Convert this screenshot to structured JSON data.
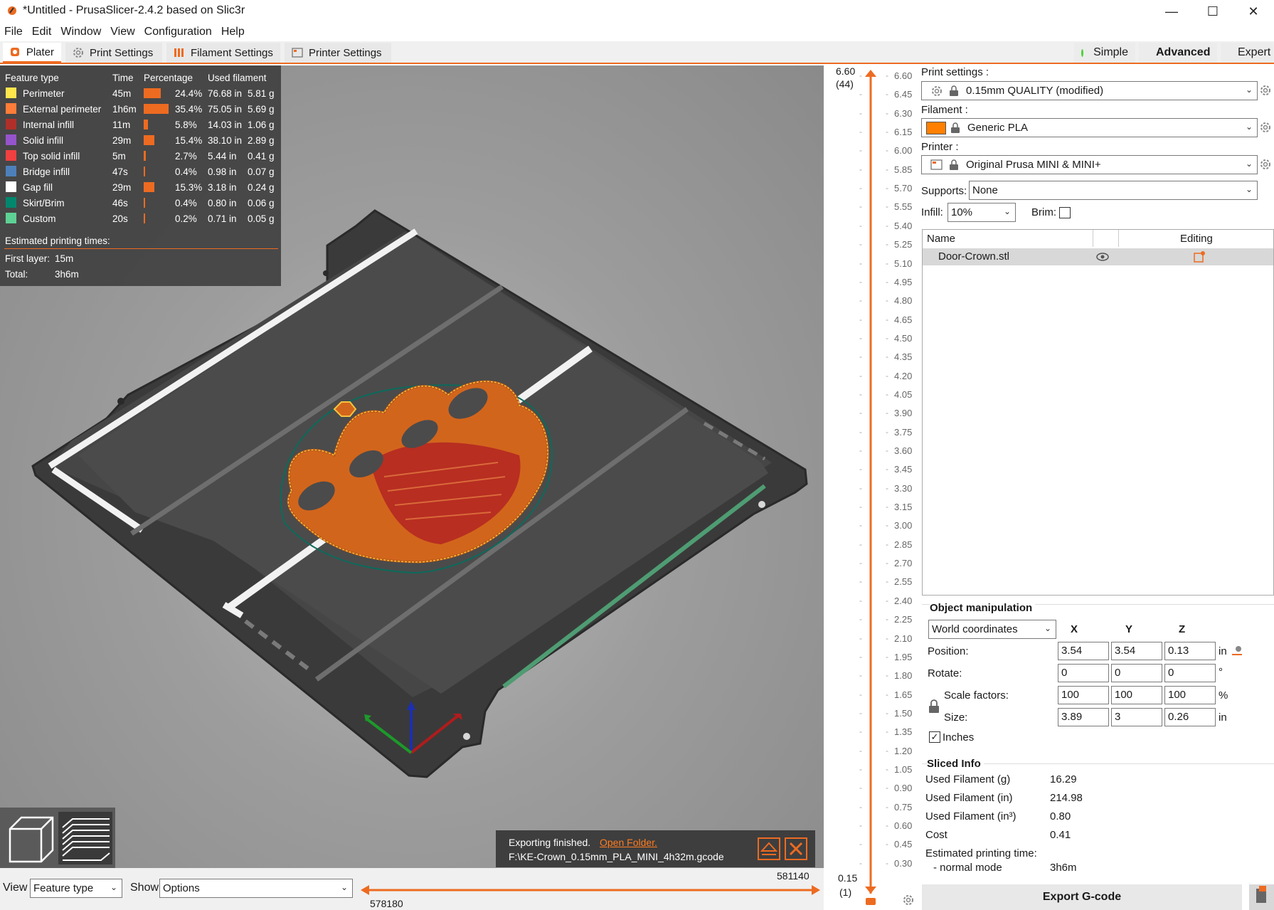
{
  "window": {
    "title": "*Untitled - PrusaSlicer-2.4.2 based on Slic3r",
    "minimize": "—",
    "maximize": "☐",
    "close": "✕"
  },
  "menu": [
    "File",
    "Edit",
    "Window",
    "View",
    "Configuration",
    "Help"
  ],
  "tabs": [
    {
      "label": "Plater",
      "active": true
    },
    {
      "label": "Print Settings",
      "active": false
    },
    {
      "label": "Filament Settings",
      "active": false
    },
    {
      "label": "Printer Settings",
      "active": false
    }
  ],
  "modes": [
    {
      "label": "Simple",
      "color": "#4cd137"
    },
    {
      "label": "Advanced",
      "color": "#f5c518",
      "active": true
    },
    {
      "label": "Expert",
      "color": "#d40000"
    }
  ],
  "legend": {
    "headers": {
      "feature": "Feature type",
      "time": "Time",
      "percentage": "Percentage",
      "used": "Used filament"
    },
    "rows": [
      {
        "name": "Perimeter",
        "time": "45m",
        "pct": "24.4%",
        "len": "76.68 in",
        "wt": "5.81 g",
        "color": "#ffe64d",
        "frac": 0.244
      },
      {
        "name": "External perimeter",
        "time": "1h6m",
        "pct": "35.4%",
        "len": "75.05 in",
        "wt": "5.69 g",
        "color": "#ff7d38",
        "frac": 0.354
      },
      {
        "name": "Internal infill",
        "time": "11m",
        "pct": "5.8%",
        "len": "14.03 in",
        "wt": "1.06 g",
        "color": "#b03029",
        "frac": 0.058
      },
      {
        "name": "Solid infill",
        "time": "29m",
        "pct": "15.4%",
        "len": "38.10 in",
        "wt": "2.89 g",
        "color": "#9654cc",
        "frac": 0.154
      },
      {
        "name": "Top solid infill",
        "time": "5m",
        "pct": "2.7%",
        "len": "5.44 in",
        "wt": "0.41 g",
        "color": "#f04040",
        "frac": 0.027
      },
      {
        "name": "Bridge infill",
        "time": "47s",
        "pct": "0.4%",
        "len": "0.98 in",
        "wt": "0.07 g",
        "color": "#4d80ba",
        "frac": 0.004
      },
      {
        "name": "Gap fill",
        "time": "29m",
        "pct": "15.3%",
        "len": "3.18 in",
        "wt": "0.24 g",
        "color": "#ffffff",
        "frac": 0.153
      },
      {
        "name": "Skirt/Brim",
        "time": "46s",
        "pct": "0.4%",
        "len": "0.80 in",
        "wt": "0.06 g",
        "color": "#00876e",
        "frac": 0.004
      },
      {
        "name": "Custom",
        "time": "20s",
        "pct": "0.2%",
        "len": "0.71 in",
        "wt": "0.05 g",
        "color": "#5ed194",
        "frac": 0.002
      }
    ],
    "estimated_label": "Estimated printing times:",
    "first_layer_label": "First layer:",
    "first_layer_value": "15m",
    "total_label": "Total:",
    "total_value": "3h6m"
  },
  "vscale": {
    "top_value": "6.60",
    "top_layer": "(44)",
    "bottom_value": "0.15",
    "bottom_layer": "(1)",
    "ticks": [
      "6.60",
      "6.45",
      "6.30",
      "6.15",
      "6.00",
      "5.85",
      "5.70",
      "5.55",
      "5.40",
      "5.25",
      "5.10",
      "4.95",
      "4.80",
      "4.65",
      "4.50",
      "4.35",
      "4.20",
      "4.05",
      "3.90",
      "3.75",
      "3.60",
      "3.45",
      "3.30",
      "3.15",
      "3.00",
      "2.85",
      "2.70",
      "2.55",
      "2.40",
      "2.25",
      "2.10",
      "1.95",
      "1.80",
      "1.65",
      "1.50",
      "1.35",
      "1.20",
      "1.05",
      "0.90",
      "0.75",
      "0.60",
      "0.45",
      "0.30"
    ]
  },
  "sidebar": {
    "print_settings_label": "Print settings :",
    "print_settings_value": "0.15mm QUALITY (modified)",
    "filament_label": "Filament :",
    "filament_value": "Generic PLA",
    "filament_color": "#ff8000",
    "printer_label": "Printer :",
    "printer_value": "Original Prusa MINI & MINI+",
    "supports_label": "Supports:",
    "supports_value": "None",
    "infill_label": "Infill:",
    "infill_value": "10%",
    "brim_label": "Brim:",
    "list_headers": {
      "name": "Name",
      "editing": "Editing"
    },
    "objects": [
      {
        "name": "Door-Crown.stl"
      }
    ]
  },
  "object_manipulation": {
    "title": "Object manipulation",
    "coords": "World coordinates",
    "axes": [
      "X",
      "Y",
      "Z"
    ],
    "position_label": "Position:",
    "position": [
      "3.54",
      "3.54",
      "0.13"
    ],
    "position_unit": "in",
    "rotate_label": "Rotate:",
    "rotate": [
      "0",
      "0",
      "0"
    ],
    "rotate_unit": "°",
    "scale_label": "Scale factors:",
    "scale": [
      "100",
      "100",
      "100"
    ],
    "scale_unit": "%",
    "size_label": "Size:",
    "size": [
      "3.89",
      "3",
      "0.26"
    ],
    "size_unit": "in",
    "inches_label": "Inches",
    "inches_checked": true
  },
  "sliced_info": {
    "title": "Sliced Info",
    "rows": [
      {
        "label": "Used Filament (g)",
        "value": "16.29"
      },
      {
        "label": "Used Filament (in)",
        "value": "214.98"
      },
      {
        "label": "Used Filament (in³)",
        "value": "0.80"
      },
      {
        "label": "Cost",
        "value": "0.41"
      }
    ],
    "estimated_label": "Estimated printing time:",
    "normal_mode_label": "- normal mode",
    "normal_mode_value": "3h6m"
  },
  "export_button": "Export G-code",
  "notification": {
    "message": "Exporting finished.",
    "link": "Open Folder.",
    "path": "F:\\KE-Crown_0.15mm_PLA_MINI_4h32m.gcode"
  },
  "bottom": {
    "view_label": "View",
    "view_value": "Feature type",
    "show_label": "Show",
    "show_value": "Options",
    "hslider_right": "581140",
    "hslider_left": "578180"
  }
}
